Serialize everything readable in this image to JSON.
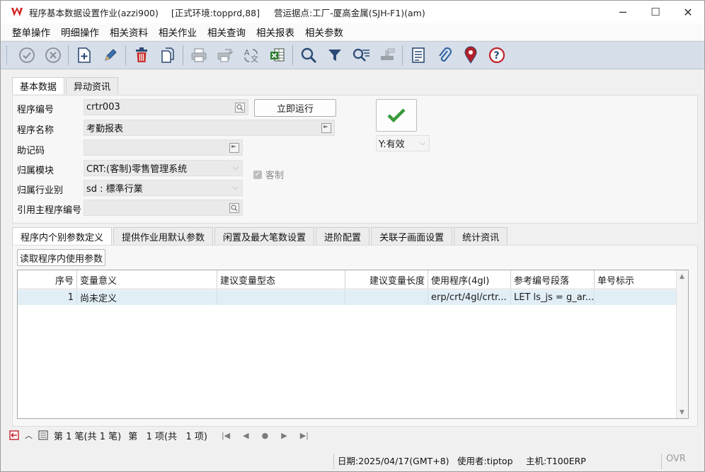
{
  "window": {
    "title_program": "程序基本数据设置作业(azzi900)",
    "title_env": "[正式环境:topprd,88]",
    "title_site": "营运据点:工厂-厦高金属(SJH-F1)(am)",
    "minimize": "─",
    "maximize": "☐",
    "close": "✕"
  },
  "menu": [
    "整单操作",
    "明细操作",
    "相关资料",
    "相关作业",
    "相关查询",
    "相关报表",
    "相关参数"
  ],
  "toolbar": {
    "icons": [
      "confirm-icon",
      "cancel-icon",
      "add-icon",
      "edit-icon",
      "delete-icon",
      "copy-icon",
      "print-icon",
      "export-icon",
      "translate-icon",
      "excel-icon",
      "search-icon",
      "filter-icon",
      "query-list-icon",
      "stamp-icon",
      "report-icon",
      "attach-icon",
      "location-icon",
      "help-icon"
    ]
  },
  "top_tabs": [
    "基本数据",
    "异动资讯"
  ],
  "form": {
    "program_no_label": "程序编号",
    "program_no_value": "crtr003",
    "run_button": "立即运行",
    "program_name_label": "程序名称",
    "program_name_value": "考勤报表",
    "mnemonic_label": "助记码",
    "mnemonic_value": "",
    "module_label": "归属模块",
    "module_value": "CRT:(客制)零售管理系统",
    "custom_label": "客制",
    "custom_checked": true,
    "industry_label": "归属行业别",
    "industry_value": "sd : 標準行業",
    "main_program_label": "引用主程序编号",
    "main_program_value": "",
    "valid_value": "Y:有效"
  },
  "bottom_tabs": [
    "程序内个别参数定义",
    "提供作业用默认参数",
    "闲置及最大笔数设置",
    "进阶配置",
    "关联子画面设置",
    "统计资讯"
  ],
  "read_button": "读取程序内使用参数",
  "grid": {
    "headers": [
      "序号",
      "变量意义",
      "建议变量型态",
      "建议变量长度",
      "使用程序(4gl)",
      "参考编号段落",
      "单号标示"
    ],
    "rows": [
      [
        "1",
        "尚未定义",
        "",
        "",
        "erp/crt/4gl/crtr...",
        "LET ls_js = g_ar...",
        ""
      ]
    ]
  },
  "pager": {
    "record_text": "第 1 笔(共 1 笔)",
    "page_text": "第   1 项(共   1 项)"
  },
  "status": {
    "date": "日期:2025/04/17(GMT+8)",
    "user": "使用者:tiptop",
    "host": "主机:T100ERP",
    "mode": "OVR"
  },
  "colors": {
    "toolbar_bg": "#d6dee9",
    "selected_row": "#e1eef5",
    "confirm_green": "#3a9a3a"
  }
}
